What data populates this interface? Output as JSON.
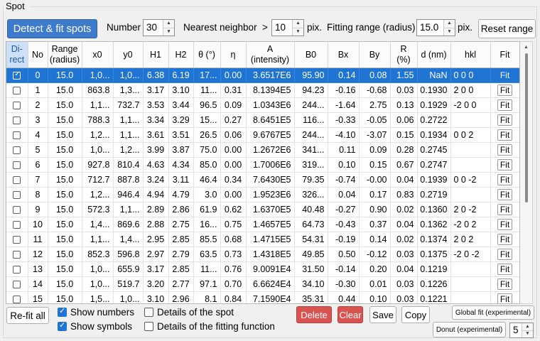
{
  "group_title": "Spot",
  "toolbar": {
    "detect_label": "Detect & fit spots",
    "number_label": "Number",
    "number_value": "30",
    "nearest_label": "Nearest neighbor",
    "nearest_op": ">",
    "nearest_value": "10",
    "nearest_unit": "pix.",
    "fitting_label": "Fitting range (radius)",
    "fitting_value": "15.0",
    "fitting_unit": "pix.",
    "reset_label": "Reset range"
  },
  "table": {
    "headers": [
      "Di-\nrect",
      "No",
      "Range\n(radius)",
      "x0",
      "y0",
      "H1",
      "H2",
      "θ (°)",
      "η",
      "A\n(intensity)",
      "B0",
      "Bx",
      "By",
      "R\n(%)",
      "d (nm)",
      "hkl",
      "Fit"
    ],
    "fit_label": "Fit",
    "selected_row": 0,
    "rows": [
      {
        "direct": true,
        "no": "0",
        "range": "15.0",
        "x0": "1,0...",
        "y0": "1,0...",
        "h1": "6.38",
        "h2": "6.19",
        "theta": "17...",
        "eta": "0.00",
        "a": "3.6517E6",
        "b0": "95.90",
        "bx": "0.14",
        "by": "0.08",
        "r": "1.55",
        "d": "NaN",
        "hkl": "0 0 0"
      },
      {
        "direct": false,
        "no": "1",
        "range": "15.0",
        "x0": "863.8",
        "y0": "1,3...",
        "h1": "3.17",
        "h2": "3.10",
        "theta": "11...",
        "eta": "0.31",
        "a": "8.1394E5",
        "b0": "94.23",
        "bx": "-0.16",
        "by": "-0.68",
        "r": "0.03",
        "d": "0.1930",
        "hkl": "2 0 0"
      },
      {
        "direct": false,
        "no": "2",
        "range": "15.0",
        "x0": "1,1...",
        "y0": "732.7",
        "h1": "3.53",
        "h2": "3.44",
        "theta": "96.5",
        "eta": "0.09",
        "a": "1.0343E6",
        "b0": "244...",
        "bx": "-1.64",
        "by": "2.75",
        "r": "0.13",
        "d": "0.1929",
        "hkl": "-2 0 0"
      },
      {
        "direct": false,
        "no": "3",
        "range": "15.0",
        "x0": "788.3",
        "y0": "1,1...",
        "h1": "3.34",
        "h2": "3.29",
        "theta": "15...",
        "eta": "0.27",
        "a": "8.6451E5",
        "b0": "116...",
        "bx": "-0.33",
        "by": "-0.05",
        "r": "0.06",
        "d": "0.2722",
        "hkl": ""
      },
      {
        "direct": false,
        "no": "4",
        "range": "15.0",
        "x0": "1,2...",
        "y0": "1,1...",
        "h1": "3.61",
        "h2": "3.51",
        "theta": "26.5",
        "eta": "0.06",
        "a": "9.6767E5",
        "b0": "244...",
        "bx": "-4.10",
        "by": "-3.07",
        "r": "0.15",
        "d": "0.1934",
        "hkl": "0 0 2"
      },
      {
        "direct": false,
        "no": "5",
        "range": "15.0",
        "x0": "1,0...",
        "y0": "1,2...",
        "h1": "3.99",
        "h2": "3.87",
        "theta": "75.0",
        "eta": "0.00",
        "a": "1.2672E6",
        "b0": "341...",
        "bx": "0.11",
        "by": "0.09",
        "r": "0.28",
        "d": "0.2745",
        "hkl": ""
      },
      {
        "direct": false,
        "no": "6",
        "range": "15.0",
        "x0": "927.8",
        "y0": "810.4",
        "h1": "4.63",
        "h2": "4.34",
        "theta": "85.0",
        "eta": "0.00",
        "a": "1.7006E6",
        "b0": "319...",
        "bx": "0.10",
        "by": "0.15",
        "r": "0.67",
        "d": "0.2747",
        "hkl": ""
      },
      {
        "direct": false,
        "no": "7",
        "range": "15.0",
        "x0": "712.7",
        "y0": "887.8",
        "h1": "3.24",
        "h2": "3.11",
        "theta": "46.4",
        "eta": "0.34",
        "a": "7.6430E5",
        "b0": "79.35",
        "bx": "-0.74",
        "by": "-0.00",
        "r": "0.04",
        "d": "0.1939",
        "hkl": "0 0 -2"
      },
      {
        "direct": false,
        "no": "8",
        "range": "15.0",
        "x0": "1,2...",
        "y0": "946.4",
        "h1": "4.94",
        "h2": "4.79",
        "theta": "3.0",
        "eta": "0.00",
        "a": "1.9523E6",
        "b0": "326...",
        "bx": "0.04",
        "by": "0.17",
        "r": "0.83",
        "d": "0.2719",
        "hkl": ""
      },
      {
        "direct": false,
        "no": "9",
        "range": "15.0",
        "x0": "572.3",
        "y0": "1,1...",
        "h1": "2.89",
        "h2": "2.86",
        "theta": "61.9",
        "eta": "0.62",
        "a": "1.6370E5",
        "b0": "40.48",
        "bx": "-0.27",
        "by": "0.90",
        "r": "0.02",
        "d": "0.1360",
        "hkl": "2 0 -2"
      },
      {
        "direct": false,
        "no": "10",
        "range": "15.0",
        "x0": "1,4...",
        "y0": "869.6",
        "h1": "2.88",
        "h2": "2.75",
        "theta": "16...",
        "eta": "0.75",
        "a": "1.4657E5",
        "b0": "64.73",
        "bx": "-0.43",
        "by": "0.37",
        "r": "0.04",
        "d": "0.1362",
        "hkl": "-2 0 2"
      },
      {
        "direct": false,
        "no": "11",
        "range": "15.0",
        "x0": "1,1...",
        "y0": "1,4...",
        "h1": "2.95",
        "h2": "2.85",
        "theta": "85.5",
        "eta": "0.68",
        "a": "1.4715E5",
        "b0": "54.31",
        "bx": "-0.19",
        "by": "0.14",
        "r": "0.02",
        "d": "0.1374",
        "hkl": "2 0 2"
      },
      {
        "direct": false,
        "no": "12",
        "range": "15.0",
        "x0": "852.3",
        "y0": "596.8",
        "h1": "2.97",
        "h2": "2.79",
        "theta": "63.5",
        "eta": "0.73",
        "a": "1.4318E5",
        "b0": "49.85",
        "bx": "0.50",
        "by": "-0.12",
        "r": "0.03",
        "d": "0.1375",
        "hkl": "-2 0 -2"
      },
      {
        "direct": false,
        "no": "13",
        "range": "15.0",
        "x0": "1,0...",
        "y0": "655.9",
        "h1": "3.17",
        "h2": "2.85",
        "theta": "11...",
        "eta": "0.76",
        "a": "9.0091E4",
        "b0": "31.50",
        "bx": "-0.14",
        "by": "0.20",
        "r": "0.04",
        "d": "0.1219",
        "hkl": ""
      },
      {
        "direct": false,
        "no": "14",
        "range": "15.0",
        "x0": "1,0...",
        "y0": "519.7",
        "h1": "3.20",
        "h2": "2.77",
        "theta": "97.1",
        "eta": "0.70",
        "a": "6.6624E4",
        "b0": "34.10",
        "bx": "-0.30",
        "by": "0.01",
        "r": "0.03",
        "d": "0.1226",
        "hkl": ""
      },
      {
        "direct": false,
        "no": "15",
        "range": "15.0",
        "x0": "1,5...",
        "y0": "1,0...",
        "h1": "3.10",
        "h2": "2.96",
        "theta": "8.1",
        "eta": "0.84",
        "a": "7.1590E4",
        "b0": "35.31",
        "bx": "0.44",
        "by": "0.10",
        "r": "0.03",
        "d": "0.1221",
        "hkl": ""
      }
    ]
  },
  "bottom": {
    "refit_label": "Re-fit all",
    "show_numbers_label": "Show numbers",
    "show_numbers_checked": true,
    "show_symbols_label": "Show symbols",
    "show_symbols_checked": true,
    "details_spot_label": "Details of the spot",
    "details_spot_checked": false,
    "details_fitting_label": "Details of the fitting function",
    "details_fitting_checked": false,
    "delete_label": "Delete",
    "clear_label": "Clear",
    "save_label": "Save",
    "copy_label": "Copy",
    "global_fit_label": "Global fit  (experimental)",
    "donut_label": "Donut  (experimental)",
    "donut_value": "5"
  },
  "colors": {
    "accent": "#3e7bcd",
    "selection": "#1f74d4",
    "danger": "#d9534f"
  }
}
